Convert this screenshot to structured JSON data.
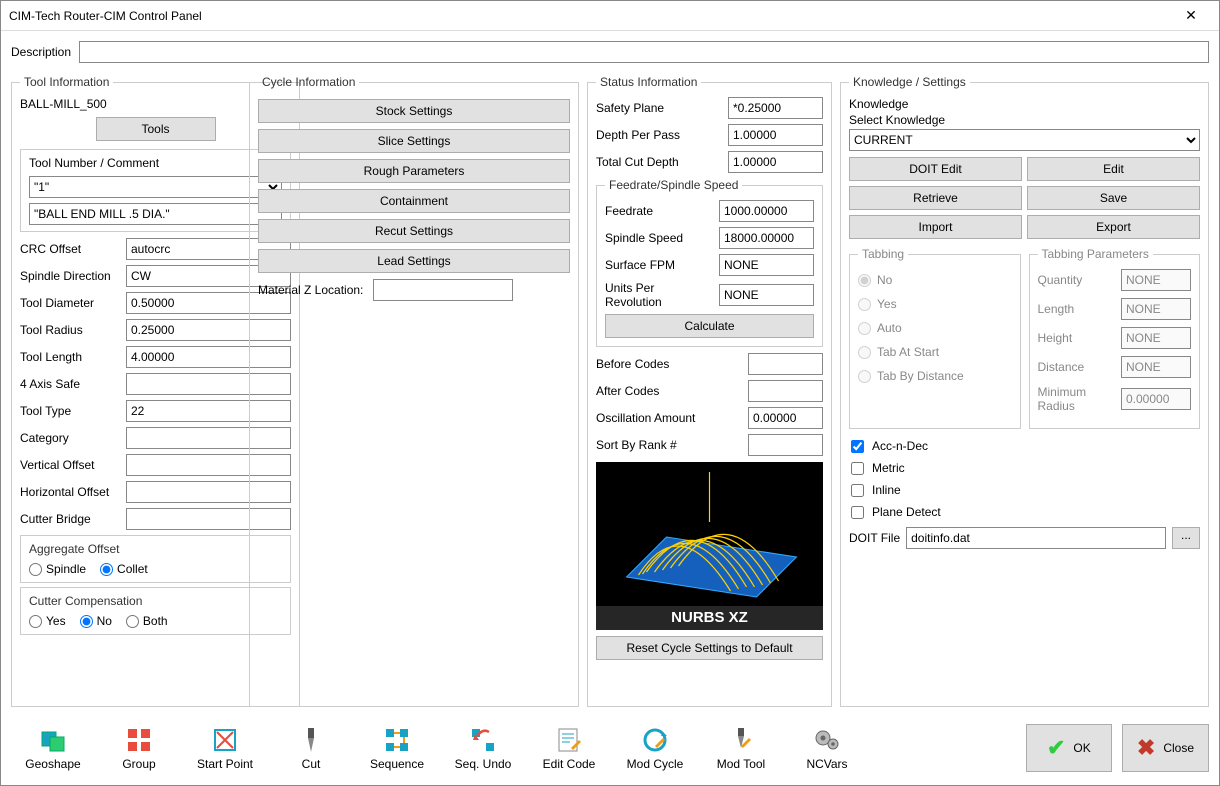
{
  "titlebar": {
    "title": "CIM-Tech Router-CIM Control Panel"
  },
  "description": {
    "label": "Description",
    "value": ""
  },
  "toolInfo": {
    "legend": "Tool Information",
    "name": "BALL-MILL_500",
    "toolsBtn": "Tools",
    "numberComment": {
      "title": "Tool Number / Comment",
      "number": "\"1\"",
      "comment": "\"BALL END MILL .5 DIA.\""
    },
    "fields": {
      "crcOffset": {
        "label": "CRC Offset",
        "value": "autocrc"
      },
      "spindleDir": {
        "label": "Spindle Direction",
        "value": "CW"
      },
      "toolDiameter": {
        "label": "Tool Diameter",
        "value": "0.50000"
      },
      "toolRadius": {
        "label": "Tool Radius",
        "value": "0.25000"
      },
      "toolLength": {
        "label": "Tool Length",
        "value": "4.00000"
      },
      "fourAxisSafe": {
        "label": "4 Axis Safe",
        "value": ""
      },
      "toolType": {
        "label": "Tool Type",
        "value": "22"
      },
      "category": {
        "label": "Category",
        "value": ""
      },
      "vOffset": {
        "label": "Vertical Offset",
        "value": ""
      },
      "hOffset": {
        "label": "Horizontal Offset",
        "value": ""
      },
      "cutterBridge": {
        "label": "Cutter Bridge",
        "value": ""
      }
    },
    "aggOffset": {
      "title": "Aggregate Offset",
      "spindle": "Spindle",
      "collet": "Collet"
    },
    "cutterComp": {
      "title": "Cutter Compensation",
      "yes": "Yes",
      "no": "No",
      "both": "Both"
    }
  },
  "cycleInfo": {
    "legend": "Cycle Information",
    "buttons": [
      "Stock Settings",
      "Slice Settings",
      "Rough Parameters",
      "Containment",
      "Recut Settings",
      "Lead Settings"
    ],
    "mzl": {
      "label": "Material Z Location:",
      "value": ""
    }
  },
  "statusInfo": {
    "legend": "Status Information",
    "safetyPlane": {
      "label": "Safety Plane",
      "value": "*0.25000"
    },
    "depthPerPass": {
      "label": "Depth Per Pass",
      "value": "1.00000"
    },
    "totalCutDepth": {
      "label": "Total Cut Depth",
      "value": "1.00000"
    },
    "feed": {
      "legend": "Feedrate/Spindle Speed",
      "feedrate": {
        "label": "Feedrate",
        "value": "1000.00000"
      },
      "spindleSpeed": {
        "label": "Spindle Speed",
        "value": "18000.00000"
      },
      "surfaceFPM": {
        "label": "Surface FPM",
        "value": "NONE"
      },
      "upr": {
        "label": "Units Per Revolution",
        "value": "NONE"
      },
      "calcBtn": "Calculate"
    },
    "beforeCodes": {
      "label": "Before Codes",
      "value": ""
    },
    "afterCodes": {
      "label": "After Codes",
      "value": ""
    },
    "oscAmount": {
      "label": "Oscillation Amount",
      "value": "0.00000"
    },
    "sortByRank": {
      "label": "Sort By Rank #",
      "value": ""
    },
    "previewCaption": "NURBS XZ",
    "resetBtn": "Reset Cycle Settings to Default"
  },
  "knowledge": {
    "legend": "Knowledge / Settings",
    "kLabel": "Knowledge",
    "selectLabel": "Select Knowledge",
    "selectValue": "CURRENT",
    "btns": {
      "doitEdit": "DOIT Edit",
      "edit": "Edit",
      "retrieve": "Retrieve",
      "save": "Save",
      "import": "Import",
      "export": "Export"
    },
    "tabbing": {
      "legend": "Tabbing",
      "no": "No",
      "yes": "Yes",
      "auto": "Auto",
      "tabAtStart": "Tab At Start",
      "tabByDist": "Tab By Distance"
    },
    "tabParams": {
      "legend": "Tabbing Parameters",
      "quantity": {
        "label": "Quantity",
        "value": "NONE"
      },
      "length": {
        "label": "Length",
        "value": "NONE"
      },
      "height": {
        "label": "Height",
        "value": "NONE"
      },
      "distance": {
        "label": "Distance",
        "value": "NONE"
      },
      "minRadius": {
        "label": "Minimum Radius",
        "value": "0.00000"
      }
    },
    "checks": {
      "accNDec": "Acc-n-Dec",
      "metric": "Metric",
      "inline": "Inline",
      "planeDetect": "Plane Detect"
    },
    "doitFile": {
      "label": "DOIT File",
      "value": "doitinfo.dat",
      "browse": "..."
    }
  },
  "toolbar": {
    "items": [
      "Geoshape",
      "Group",
      "Start Point",
      "Cut",
      "Sequence",
      "Seq. Undo",
      "Edit Code",
      "Mod Cycle",
      "Mod Tool",
      "NCVars"
    ],
    "ok": "OK",
    "close": "Close"
  }
}
